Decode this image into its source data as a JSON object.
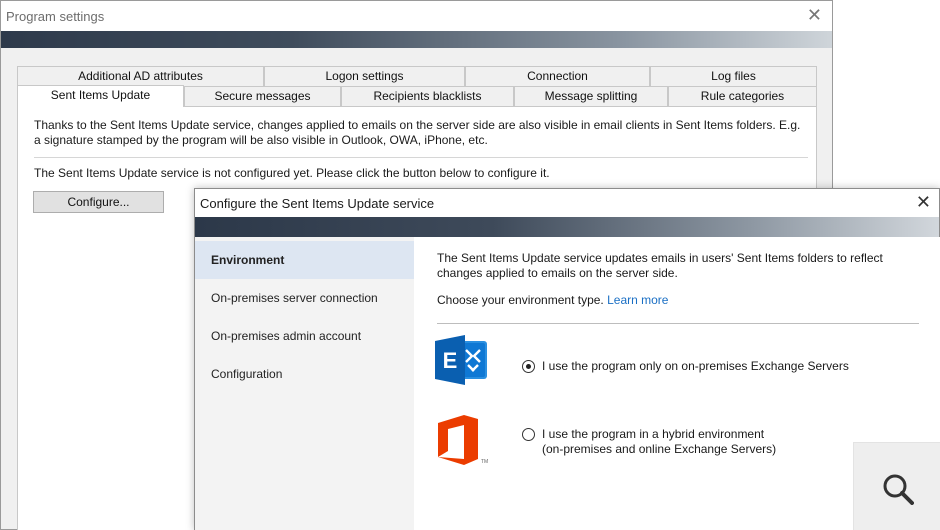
{
  "outer_window": {
    "title": "Program settings",
    "close_glyph": "✕",
    "tabs_back": [
      "Additional AD attributes",
      "Logon settings",
      "Connection",
      "Log files"
    ],
    "tabs_front": [
      "Sent Items Update",
      "Secure messages",
      "Recipients blacklists",
      "Message splitting",
      "Rule categories"
    ],
    "active_tab": "Sent Items Update",
    "description": "Thanks to the Sent Items Update service, changes applied to emails on the server side are also visible in email clients in Sent Items folders. E.g. a signature stamped by the program will be also visible in Outlook, OWA, iPhone, etc.",
    "status": "The Sent Items Update service is not configured yet. Please click the button below to configure it.",
    "configure_button": "Configure..."
  },
  "dialog": {
    "title": "Configure the Sent Items Update service",
    "close_glyph": "✕",
    "nav": {
      "items": [
        "Environment",
        "On-premises server connection",
        "On-premises admin account",
        "Configuration"
      ],
      "active": "Environment"
    },
    "intro_line1": "The Sent Items Update service updates emails in users' Sent Items folders to reflect",
    "intro_line2": "changes applied to emails on the server side.",
    "choose_text": "Choose your environment type.",
    "learn_more": "Learn more",
    "options": [
      {
        "label_line1": "I use the program only on on-premises Exchange Servers",
        "label_line2": "",
        "checked": true,
        "icon": "exchange-logo-icon"
      },
      {
        "label_line1": "I use the program in a hybrid environment",
        "label_line2": "(on-premises and online Exchange Servers)",
        "checked": false,
        "icon": "office-logo-icon"
      }
    ]
  },
  "overlay": {
    "icon": "zoom-search-icon"
  },
  "colors": {
    "accent_link": "#1a6fc4",
    "nav_active_bg": "#dde6f2",
    "exchange_blue": "#0f78d4",
    "office_orange": "#eb3c00"
  }
}
